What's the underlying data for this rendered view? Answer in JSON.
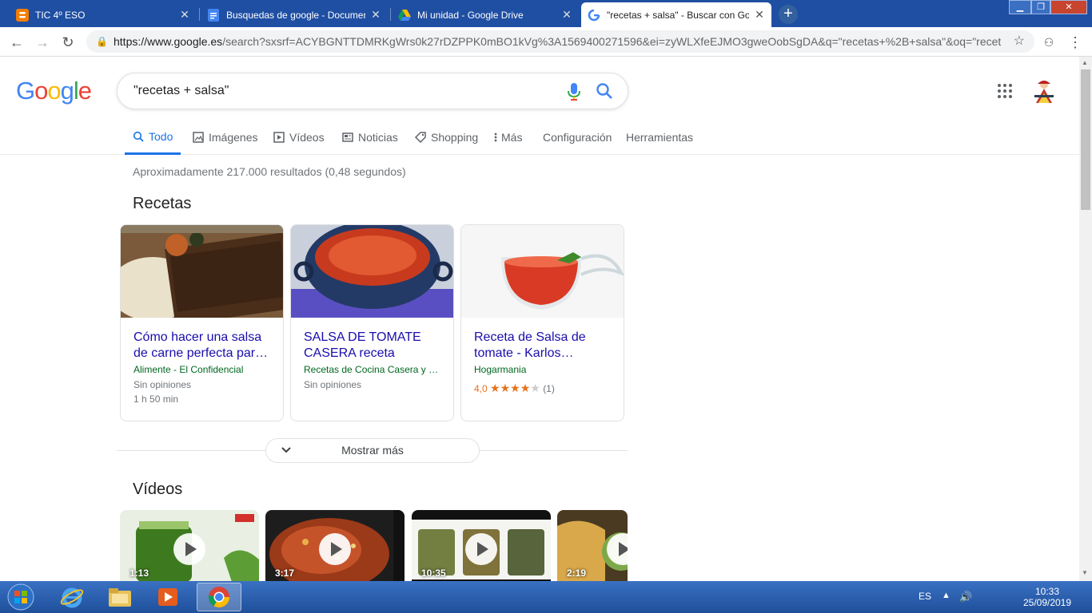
{
  "browser": {
    "tabs": [
      {
        "title": "TIC 4º ESO",
        "favicon": "blogger-icon"
      },
      {
        "title": "Busquedas de google - Documen",
        "favicon": "docs-icon"
      },
      {
        "title": "Mi unidad - Google Drive",
        "favicon": "drive-icon"
      },
      {
        "title": "\"recetas + salsa\" - Buscar con Go",
        "favicon": "google-icon",
        "active": true
      }
    ],
    "url_host": "https://www.google.es",
    "url_path": "/search?sxsrf=ACYBGNTTDMRKgWrs0k27rDZPPK0mBO1kVg%3A1569400271596&ei=zyWLXfeEJMO3gweOobSgDA&q=\"recetas+%2B+salsa\"&oq=\"receta..."
  },
  "search": {
    "logo": "Google",
    "query": "\"recetas + salsa\""
  },
  "navtabs": [
    {
      "label": "Todo",
      "icon": "search-icon",
      "active": true
    },
    {
      "label": "Imágenes",
      "icon": "image-icon"
    },
    {
      "label": "Vídeos",
      "icon": "play-icon"
    },
    {
      "label": "Noticias",
      "icon": "news-icon"
    },
    {
      "label": "Shopping",
      "icon": "tag-icon"
    },
    {
      "label": "Más",
      "icon": "more-vert-icon"
    },
    {
      "label": "Configuración"
    },
    {
      "label": "Herramientas"
    }
  ],
  "stats": "Aproximadamente 217.000 resultados (0,48 segundos)",
  "recipes": {
    "heading": "Recetas",
    "cards": [
      {
        "title": "Cómo hacer una salsa de carne perfecta par…",
        "source": "Alimente - El Confidencial",
        "meta1": "Sin opiniones",
        "meta2": "1 h 50 min"
      },
      {
        "title": "SALSA DE TOMATE CASERA receta",
        "source": "Recetas de Cocina Casera y …",
        "meta1": "Sin opiniones"
      },
      {
        "title": "Receta de Salsa de tomate - Karlos…",
        "source": "Hogarmania",
        "rating": "4,0",
        "rating_value": 4,
        "rating_count": "(1)"
      }
    ],
    "more_label": "Mostrar más"
  },
  "videos": {
    "heading": "Vídeos",
    "items": [
      {
        "duration": "1:13"
      },
      {
        "duration": "3:17"
      },
      {
        "duration": "10:35"
      },
      {
        "duration": "2:19"
      }
    ]
  },
  "taskbar": {
    "lang": "ES",
    "time": "10:33",
    "date": "25/09/2019"
  }
}
